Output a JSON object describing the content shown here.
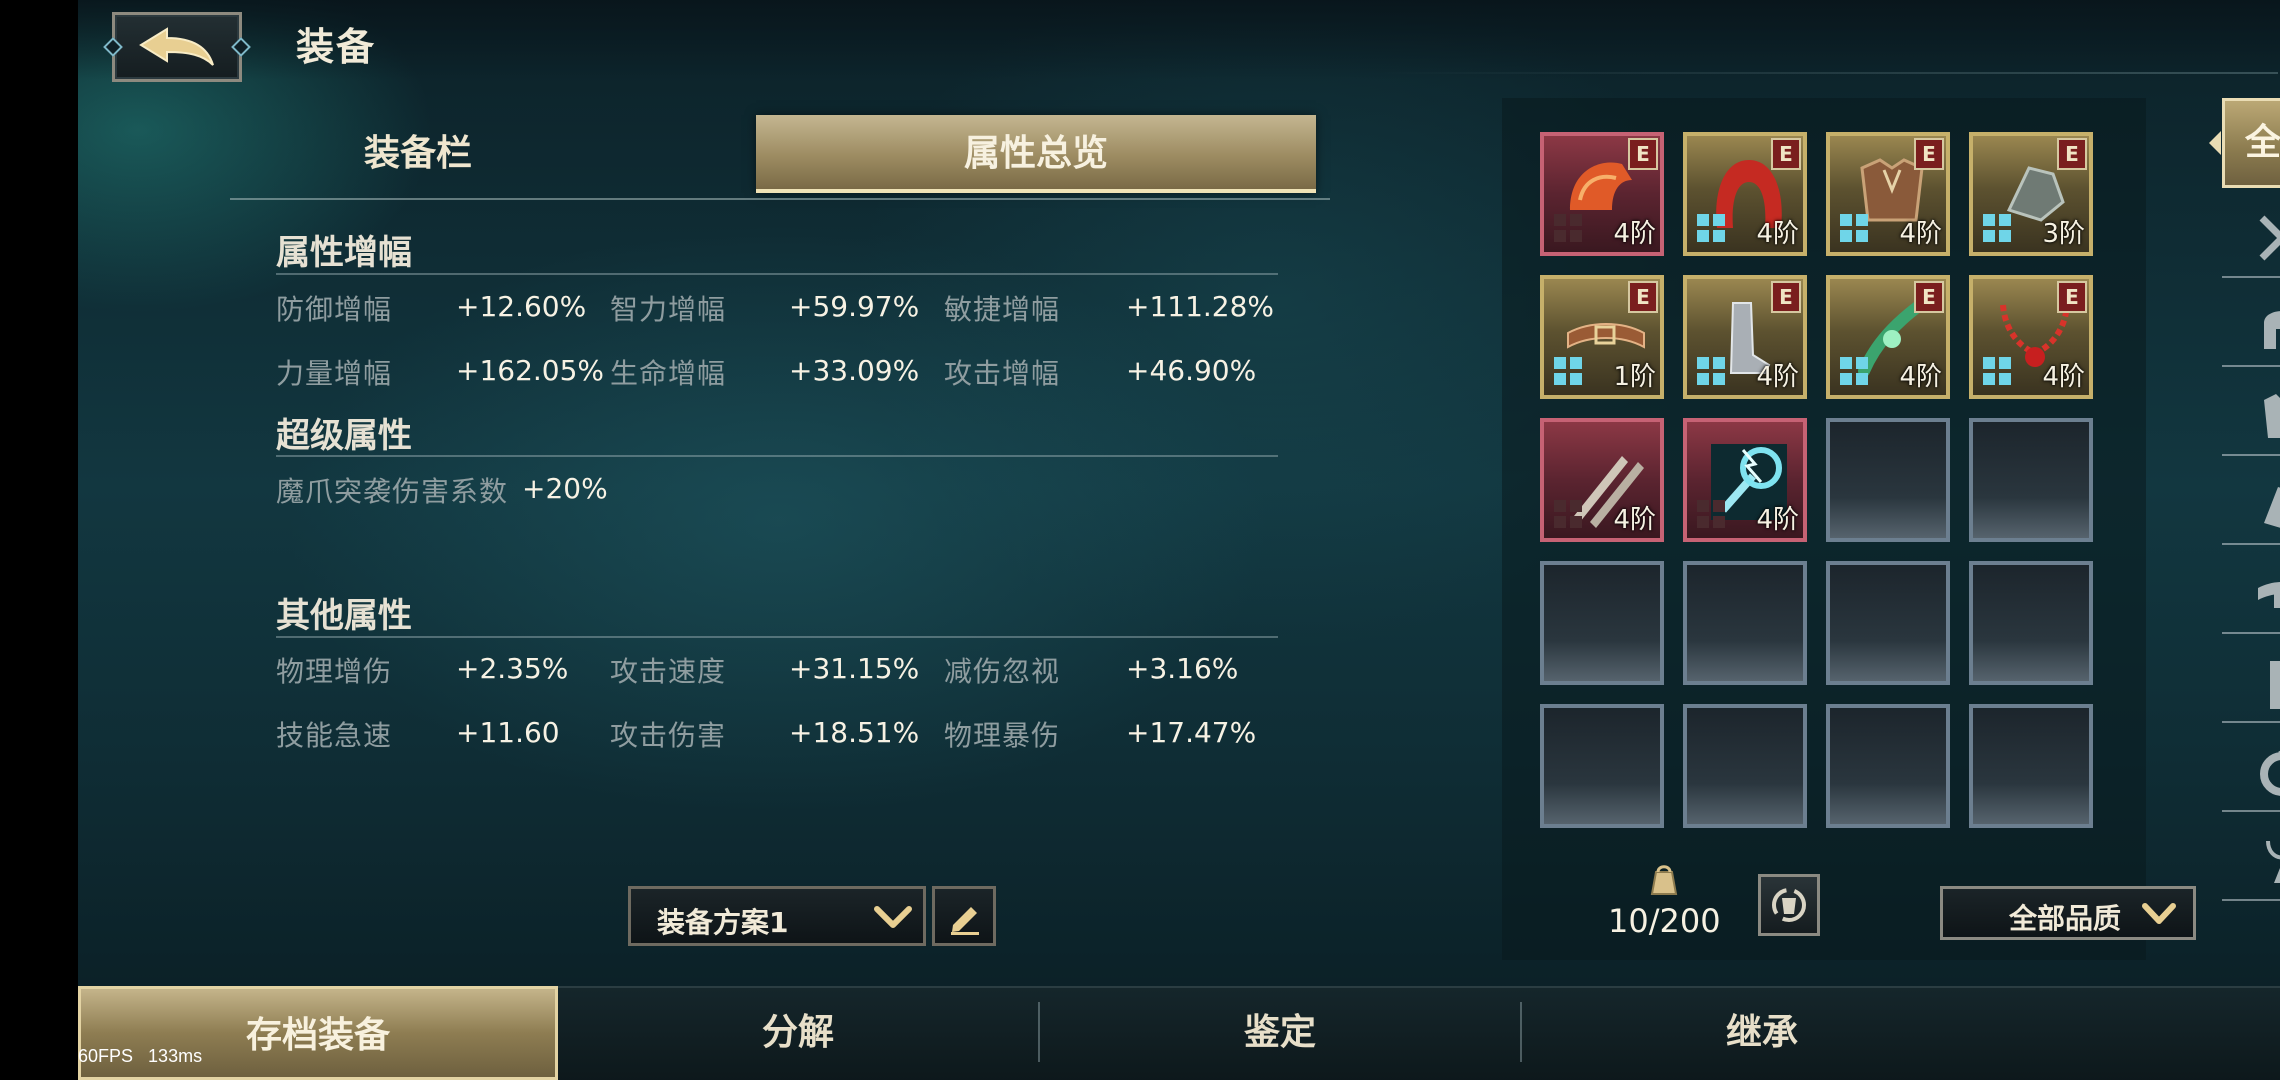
{
  "header": {
    "title": "装备"
  },
  "tabs": {
    "equip_bar": "装备栏",
    "attribute_overview": "属性总览"
  },
  "sections": {
    "amplify": {
      "title": "属性增幅",
      "rows": [
        [
          {
            "label": "防御增幅",
            "value": "+12.60%"
          },
          {
            "label": "智力增幅",
            "value": "+59.97%"
          },
          {
            "label": "敏捷增幅",
            "value": "+111.28%"
          }
        ],
        [
          {
            "label": "力量增幅",
            "value": "+162.05%"
          },
          {
            "label": "生命增幅",
            "value": "+33.09%"
          },
          {
            "label": "攻击增幅",
            "value": "+46.90%"
          }
        ]
      ]
    },
    "super": {
      "title": "超级属性",
      "item": {
        "label": "魔爪突袭伤害系数",
        "value": "+20%"
      }
    },
    "other": {
      "title": "其他属性",
      "rows": [
        [
          {
            "label": "物理增伤",
            "value": "+2.35%"
          },
          {
            "label": "攻击速度",
            "value": "+31.15%"
          },
          {
            "label": "减伤忽视",
            "value": "+3.16%"
          }
        ],
        [
          {
            "label": "技能急速",
            "value": "+11.60"
          },
          {
            "label": "攻击伤害",
            "value": "+18.51%"
          },
          {
            "label": "物理暴伤",
            "value": "+17.47%"
          }
        ]
      ]
    }
  },
  "preset": {
    "label": "装备方案1"
  },
  "inventory": {
    "items": [
      {
        "icon": "helmet-icon",
        "tier": "4阶",
        "badge": "E",
        "quality": "red"
      },
      {
        "icon": "hood-icon",
        "tier": "4阶",
        "badge": "E",
        "quality": "gold"
      },
      {
        "icon": "chest-armor-icon",
        "tier": "4阶",
        "badge": "E",
        "quality": "gold"
      },
      {
        "icon": "gauntlet-icon",
        "tier": "3阶",
        "badge": "E",
        "quality": "gold"
      },
      {
        "icon": "belt-icon",
        "tier": "1阶",
        "badge": "E",
        "quality": "gold"
      },
      {
        "icon": "boots-icon",
        "tier": "4阶",
        "badge": "E",
        "quality": "gold"
      },
      {
        "icon": "amulet-icon",
        "tier": "4阶",
        "badge": "E",
        "quality": "gold"
      },
      {
        "icon": "necklace-icon",
        "tier": "4阶",
        "badge": "E",
        "quality": "gold"
      },
      {
        "icon": "twin-daggers-icon",
        "tier": "4阶",
        "badge": "",
        "quality": "red"
      },
      {
        "icon": "lightning-mace-icon",
        "tier": "4阶",
        "badge": "",
        "quality": "red"
      }
    ],
    "empty_slots": 10,
    "count": "10/200",
    "quality_filter": "全部品质"
  },
  "categories": {
    "all_label": "全部",
    "icons": [
      "crossed-swords-icon",
      "helmet-icon",
      "chest-armor-icon",
      "gauntlet-icon",
      "belt-icon",
      "boots-icon",
      "ring-icon",
      "amulet-icon"
    ]
  },
  "bottom_tabs": {
    "archive": "存档装备",
    "decompose": "分解",
    "identify": "鉴定",
    "inherit": "继承"
  },
  "debug": {
    "fps": "60FPS",
    "latency": "133ms"
  },
  "colors": {
    "gold": "#c6b06a",
    "red": "#c66274",
    "accent_cyan": "#6fd5e8"
  }
}
